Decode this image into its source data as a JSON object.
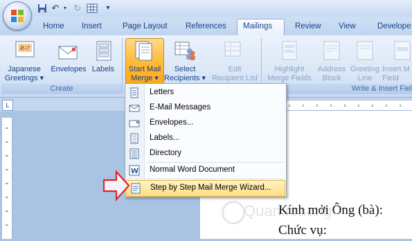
{
  "quick_access": {
    "icons": [
      "save-icon",
      "undo-icon",
      "redo-icon",
      "table-icon",
      "customize-arrow-icon"
    ]
  },
  "tabs": [
    "Home",
    "Insert",
    "Page Layout",
    "References",
    "Mailings",
    "Review",
    "View",
    "Develope"
  ],
  "active_tab": "Mailings",
  "ribbon": {
    "create": {
      "label": "Create",
      "buttons": [
        {
          "label1": "Japanese",
          "label2": "Greetings ▾"
        },
        {
          "label1": "Envelopes",
          "label2": ""
        },
        {
          "label1": "Labels",
          "label2": ""
        }
      ]
    },
    "start_mail_merge": {
      "buttons": [
        {
          "label1": "Start Mail",
          "label2": "Merge ▾"
        },
        {
          "label1": "Select",
          "label2": "Recipients ▾"
        },
        {
          "label1": "Edit",
          "label2": "Recipient List"
        }
      ]
    },
    "write_insert": {
      "label": "Write & Insert Fiel",
      "buttons": [
        {
          "label1": "Highlight",
          "label2": "Merge Fields"
        },
        {
          "label1": "Address",
          "label2": "Block"
        },
        {
          "label1": "Greeting",
          "label2": "Line"
        },
        {
          "label1": "Insert M",
          "label2": "Field"
        }
      ]
    }
  },
  "dropdown": {
    "items": [
      {
        "label": "Letters",
        "icon": "letter-icon"
      },
      {
        "label": "E-Mail Messages",
        "icon": "email-icon"
      },
      {
        "label": "Envelopes...",
        "icon": "envelope-icon"
      },
      {
        "label": "Labels...",
        "icon": "labels-icon"
      },
      {
        "label": "Directory",
        "icon": "directory-icon"
      },
      {
        "label": "Normal Word Document",
        "icon": "word-doc-icon"
      },
      {
        "label": "Step by Step Mail Merge Wizard...",
        "icon": "wizard-icon"
      }
    ],
    "highlighted_index": 6
  },
  "document": {
    "line1": "Kính mởi Ông (bà):",
    "line2": "Chức vụ:",
    "watermark": "Quantrimang"
  },
  "colors": {
    "accent_orange": "#ffbf40",
    "ribbon_blue": "#dbe7f7",
    "tab_text": "#15428b",
    "arrow_red": "#e8202a"
  }
}
